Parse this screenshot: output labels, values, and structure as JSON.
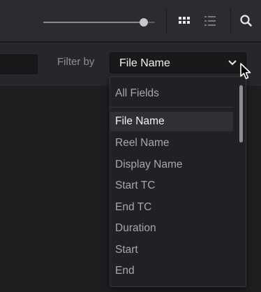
{
  "toolbar": {
    "zoom_slider_level": 0.93,
    "view_grid_icon": "grid-view-icon",
    "view_list_icon": "list-view-icon",
    "search_icon": "search-icon",
    "active_view": "grid"
  },
  "filter": {
    "label": "Filter by",
    "selected_value": "File Name",
    "options": [
      "All Fields",
      "File Name",
      "Reel Name",
      "Display Name",
      "Start TC",
      "End TC",
      "Duration",
      "Start",
      "End"
    ],
    "highlighted_option": "File Name"
  },
  "colors": {
    "background": "#1d1e20",
    "toolbar": "#2b2c2f",
    "menu": "#202124",
    "selected_text": "#f2f3f5",
    "muted_text": "#a6a8ac"
  }
}
